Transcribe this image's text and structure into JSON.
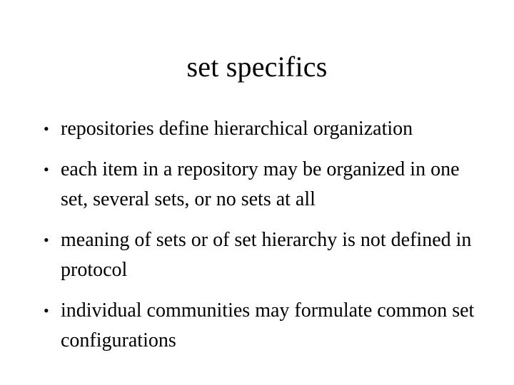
{
  "slide": {
    "title": "set specifics",
    "bullet_marker": "•",
    "bullets": [
      {
        "text": "repositories define hierarchical organization"
      },
      {
        "text": "each item in a repository may be organized in one set, several sets, or no sets at all"
      },
      {
        "text": "meaning of sets or of set hierarchy is not defined in protocol"
      },
      {
        "text": "individual communities may formulate common set configurations"
      }
    ],
    "colors": {
      "background": "#ffffff",
      "text": "#000000"
    }
  }
}
